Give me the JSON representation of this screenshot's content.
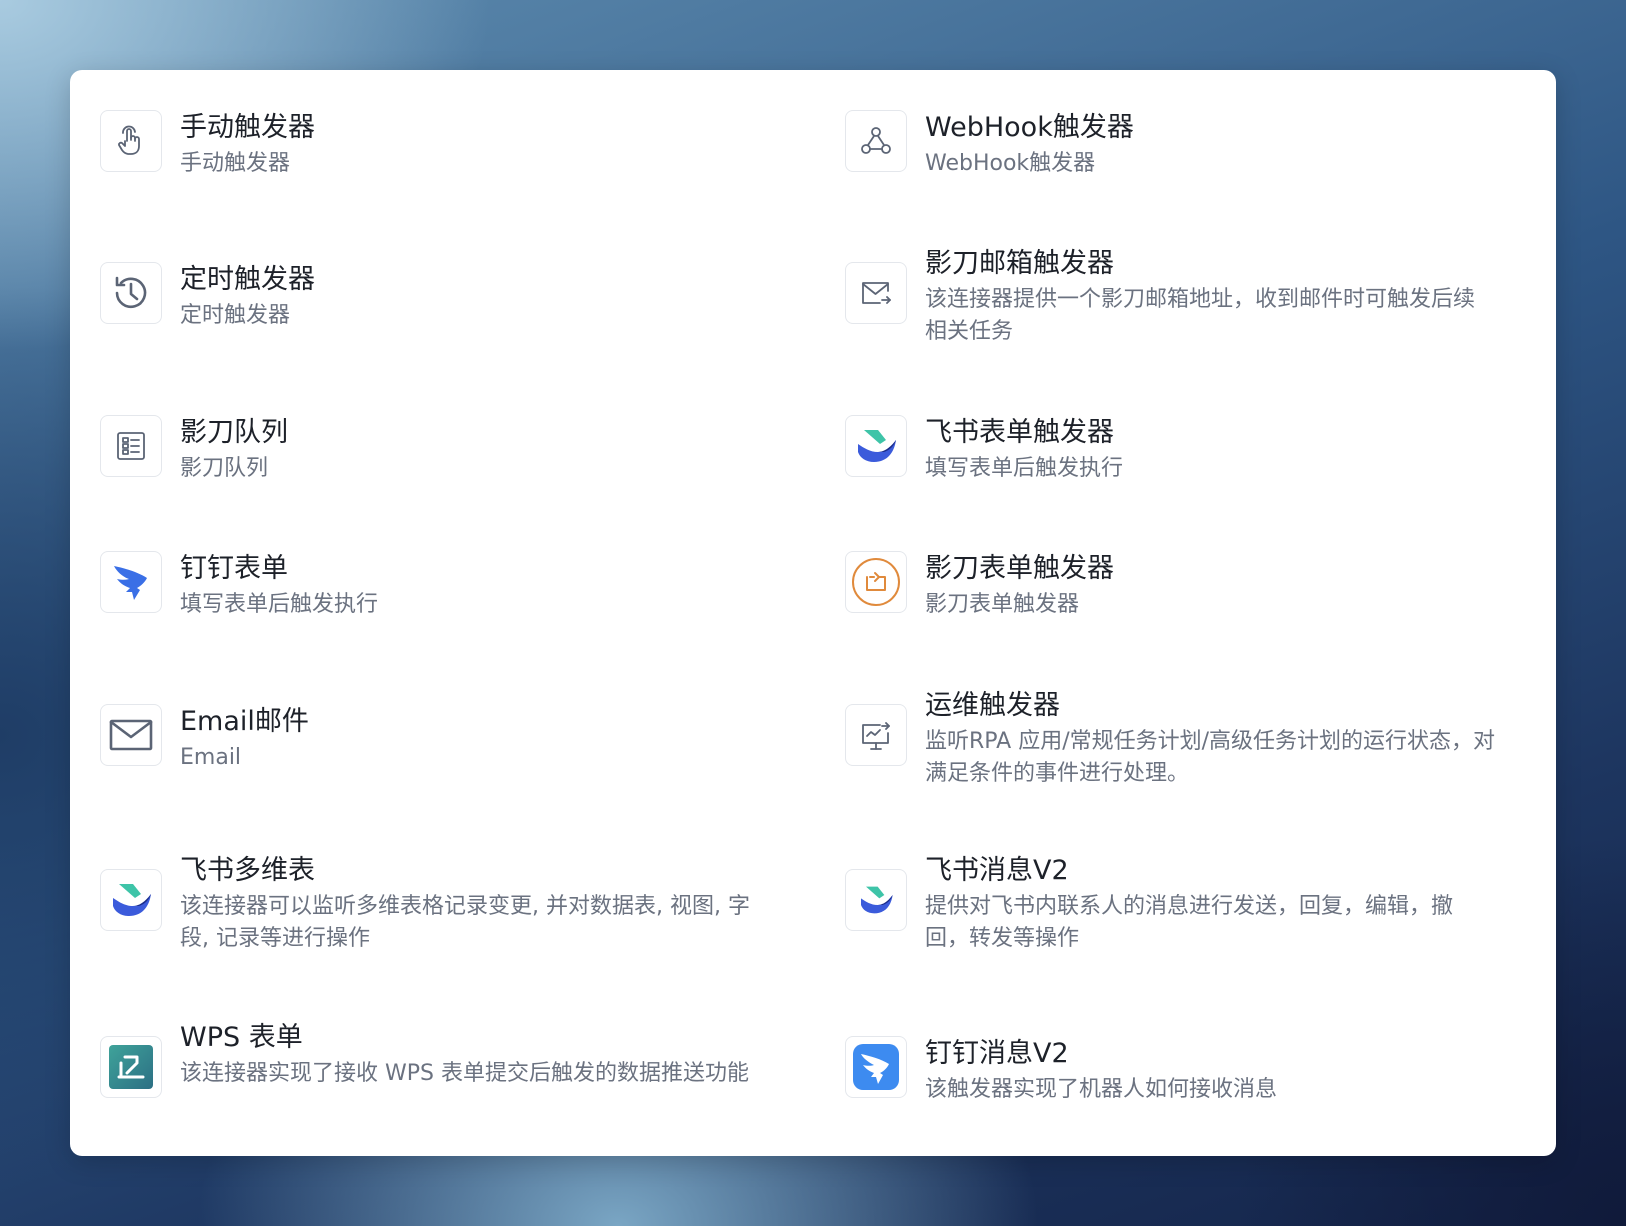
{
  "triggers": [
    {
      "title": "手动触发器",
      "desc": "手动触发器",
      "icon": "hand-pointer-icon"
    },
    {
      "title": "WebHook触发器",
      "desc": "WebHook触发器",
      "icon": "webhook-icon"
    },
    {
      "title": "定时触发器",
      "desc": "定时触发器",
      "icon": "history-clock-icon"
    },
    {
      "title": "影刀邮箱触发器",
      "desc": "该连接器提供一个影刀邮箱地址，收到邮件时可触发后续相关任务",
      "icon": "mail-forward-icon"
    },
    {
      "title": "影刀队列",
      "desc": "影刀队列",
      "icon": "queue-list-icon"
    },
    {
      "title": "飞书表单触发器",
      "desc": "填写表单后触发执行",
      "icon": "feishu-logo-icon"
    },
    {
      "title": "钉钉表单",
      "desc": "填写表单后触发执行",
      "icon": "dingtalk-logo-icon"
    },
    {
      "title": "影刀表单触发器",
      "desc": "影刀表单触发器",
      "icon": "form-trigger-icon"
    },
    {
      "title": "Email邮件",
      "desc": "Email",
      "icon": "envelope-icon"
    },
    {
      "title": "运维触发器",
      "desc": "监听RPA 应用/常规任务计划/高级任务计划的运行状态，对满足条件的事件进行处理。",
      "icon": "monitor-ops-icon"
    },
    {
      "title": "飞书多维表",
      "desc": "该连接器可以监听多维表格记录变更, 并对数据表, 视图, 字段, 记录等进行操作",
      "icon": "feishu-logo-icon"
    },
    {
      "title": "飞书消息V2",
      "desc": "提供对飞书内联系人的消息进行发送，回复，编辑，撤回，转发等操作",
      "icon": "feishu-logo-icon"
    },
    {
      "title": "WPS 表单",
      "desc": "该连接器实现了接收 WPS 表单提交后触发的数据推送功能",
      "icon": "wps-form-icon"
    },
    {
      "title": "钉钉消息V2",
      "desc": "该触发器实现了机器人如何接收消息",
      "icon": "dingtalk-app-icon"
    }
  ]
}
